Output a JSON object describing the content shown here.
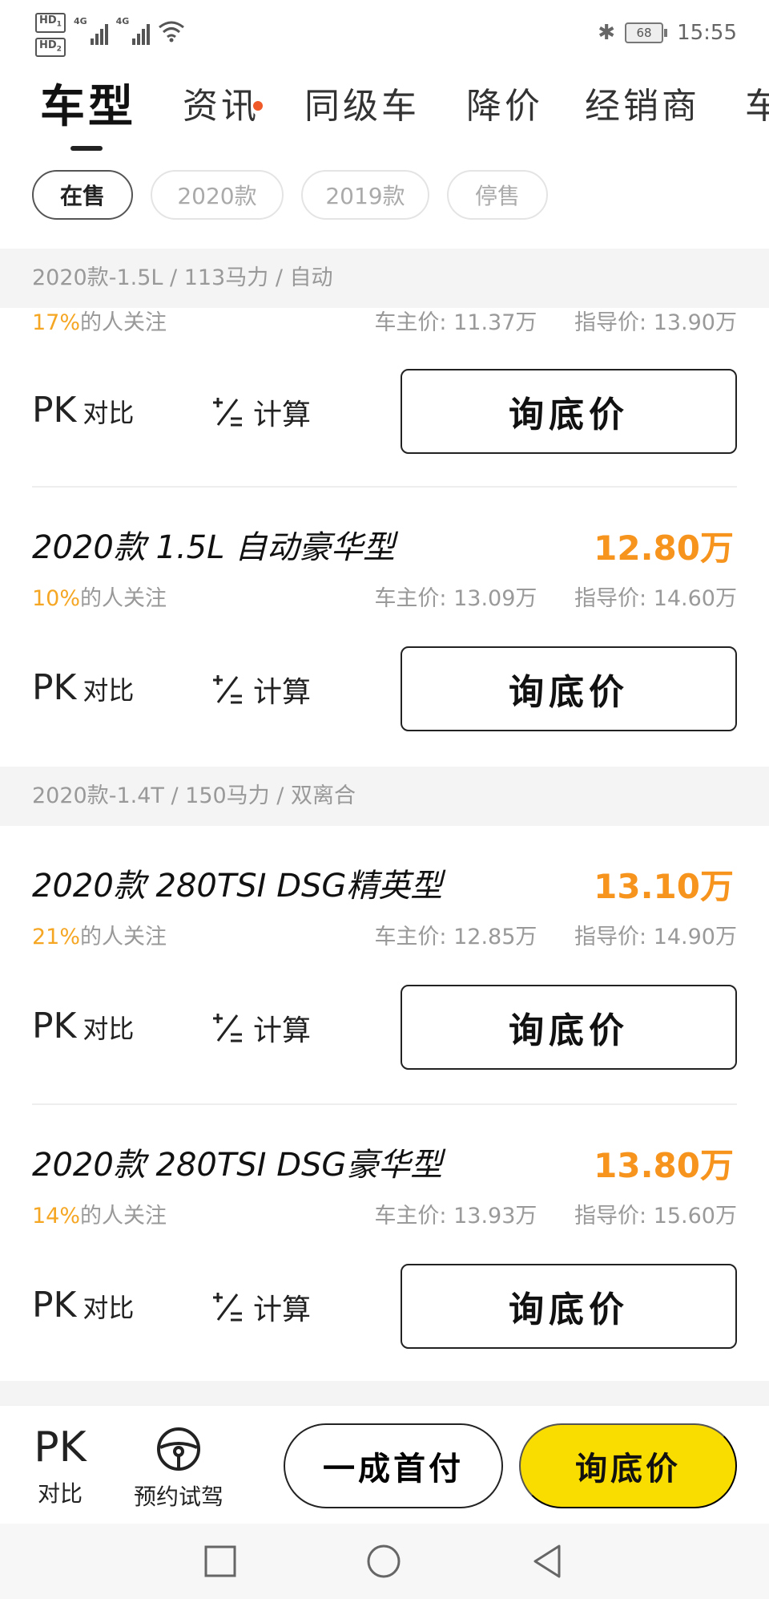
{
  "status": {
    "hd1": "HD",
    "hd1_sub": "1",
    "hd2": "HD",
    "hd2_sub": "2",
    "net1": "4G",
    "net2": "4G",
    "battery": "68",
    "time": "15:55",
    "bt_glyph": "✱"
  },
  "tabs": [
    {
      "label": "车型",
      "active": true
    },
    {
      "label": "资讯",
      "badge": true
    },
    {
      "label": "同级车"
    },
    {
      "label": "降价"
    },
    {
      "label": "经销商"
    },
    {
      "label": "车"
    }
  ],
  "filters": [
    {
      "label": "在售",
      "active": true
    },
    {
      "label": "2020款"
    },
    {
      "label": "2019款"
    },
    {
      "label": "停售"
    }
  ],
  "groups": [
    {
      "header": "2020款-1.5L / 113马力 / 自动"
    },
    {
      "header": "2020款-1.4T / 150马力 / 双离合"
    }
  ],
  "items": [
    {
      "title": "",
      "price": "",
      "pct": "17%",
      "pct_suffix": "的人关注",
      "owner_price": "车主价: 11.37万",
      "guide_price": "指导价: 13.90万"
    },
    {
      "title": "2020款 1.5L 自动豪华型",
      "price": "12.80万",
      "pct": "10%",
      "pct_suffix": "的人关注",
      "owner_price": "车主价: 13.09万",
      "guide_price": "指导价: 14.60万"
    },
    {
      "title": "2020款 280TSI DSG精英型",
      "price": "13.10万",
      "pct": "21%",
      "pct_suffix": "的人关注",
      "owner_price": "车主价: 12.85万",
      "guide_price": "指导价: 14.90万"
    },
    {
      "title": "2020款 280TSI DSG豪华型",
      "price": "13.80万",
      "pct": "14%",
      "pct_suffix": "的人关注",
      "owner_price": "车主价: 13.93万",
      "guide_price": "指导价: 15.60万"
    }
  ],
  "actions": {
    "pk": "PK",
    "pk_label": "对比",
    "calc_label": "计算",
    "ask_label": "询底价"
  },
  "bottom": {
    "pk": "PK",
    "pk_label": "对比",
    "drive_label": "预约试驾",
    "down_payment": "一成首付",
    "ask_label": "询底价",
    "accent_color": "#f9dc00"
  },
  "colors": {
    "price": "#f7941d",
    "pct": "#f5a623"
  }
}
